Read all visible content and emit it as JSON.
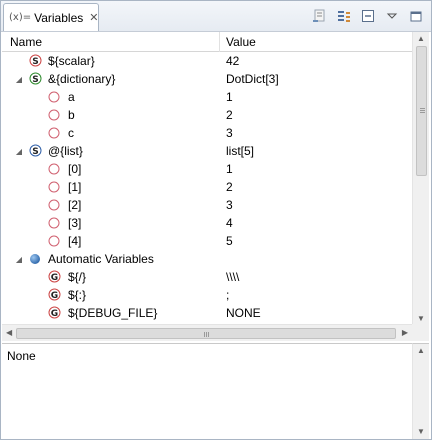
{
  "tab": {
    "icon": "(x)=",
    "title": "Variables",
    "close_icon": "close-icon"
  },
  "toolbar": {
    "buttons": [
      "show-type-names-icon",
      "collapse-all-icon",
      "minimize-icon",
      "view-menu-icon",
      "maximize-icon"
    ]
  },
  "columns": {
    "name": "Name",
    "value": "Value"
  },
  "icon_colors": {
    "scalar_s": "#cc3333",
    "local_g": "#444444",
    "item": "#d06070",
    "dict_s": "#2e8b2e",
    "list_s": "#2f5fa8",
    "folder_ball": "#3a78c2"
  },
  "rows": [
    {
      "name": "${scalar}",
      "value": "42"
    },
    {
      "name": "&{dictionary}",
      "value": "DotDict[3]"
    },
    {
      "name": "a",
      "value": "1"
    },
    {
      "name": "b",
      "value": "2"
    },
    {
      "name": "c",
      "value": "3"
    },
    {
      "name": "@{list}",
      "value": "list[5]"
    },
    {
      "name": "[0]",
      "value": "1"
    },
    {
      "name": "[1]",
      "value": "2"
    },
    {
      "name": "[2]",
      "value": "3"
    },
    {
      "name": "[3]",
      "value": "4"
    },
    {
      "name": "[4]",
      "value": "5"
    },
    {
      "name": "Automatic Variables",
      "value": ""
    },
    {
      "name": "${/}",
      "value": "\\\\\\\\"
    },
    {
      "name": "${:}",
      "value": ";"
    },
    {
      "name": "${DEBUG_FILE}",
      "value": "NONE"
    }
  ],
  "detail": {
    "text": "None"
  }
}
